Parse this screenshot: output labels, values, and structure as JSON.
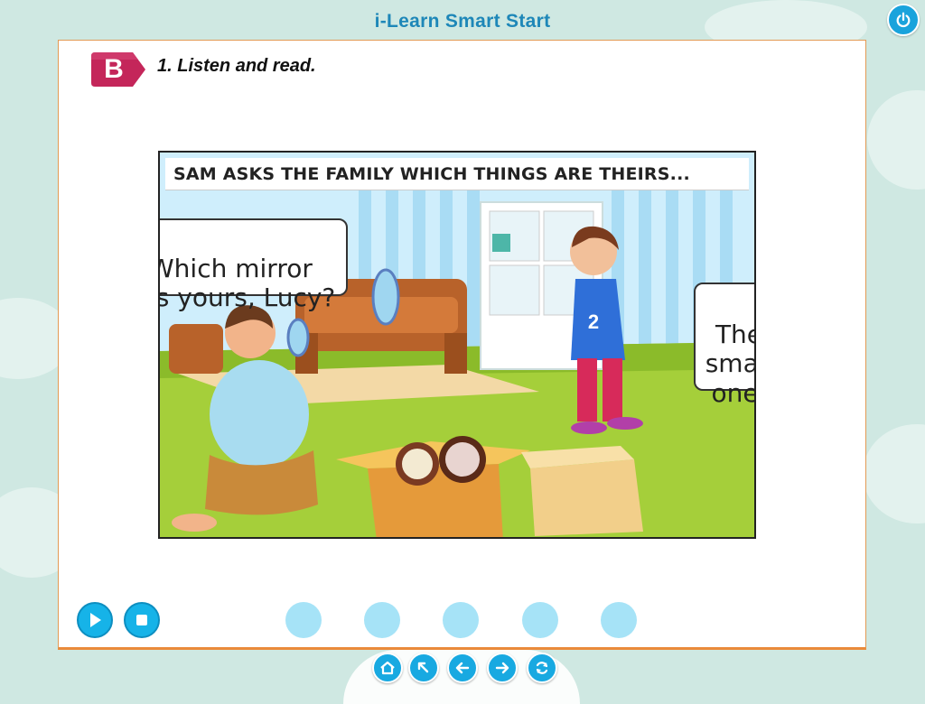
{
  "app": {
    "title": "i-Learn Smart Start"
  },
  "section": {
    "letter": "B",
    "instruction": "1. Listen and read."
  },
  "comic": {
    "caption": "SAM ASKS THE FAMILY WHICH THINGS ARE THEIRS...",
    "bubble_left": "Which mirror\nis yours, Lucy?",
    "bubble_right": "The\nsmall\none."
  },
  "player": {
    "play_icon": "play-icon",
    "stop_icon": "stop-icon",
    "page_dots": 5
  },
  "nav": {
    "icons": [
      "home-icon",
      "fullscreen-icon",
      "back-arrow-icon",
      "forward-arrow-icon",
      "refresh-icon"
    ]
  },
  "colors": {
    "accent": "#16b3e8",
    "badge": "#c4265a",
    "frame": "#ea8a3a",
    "title": "#1e87b8"
  }
}
